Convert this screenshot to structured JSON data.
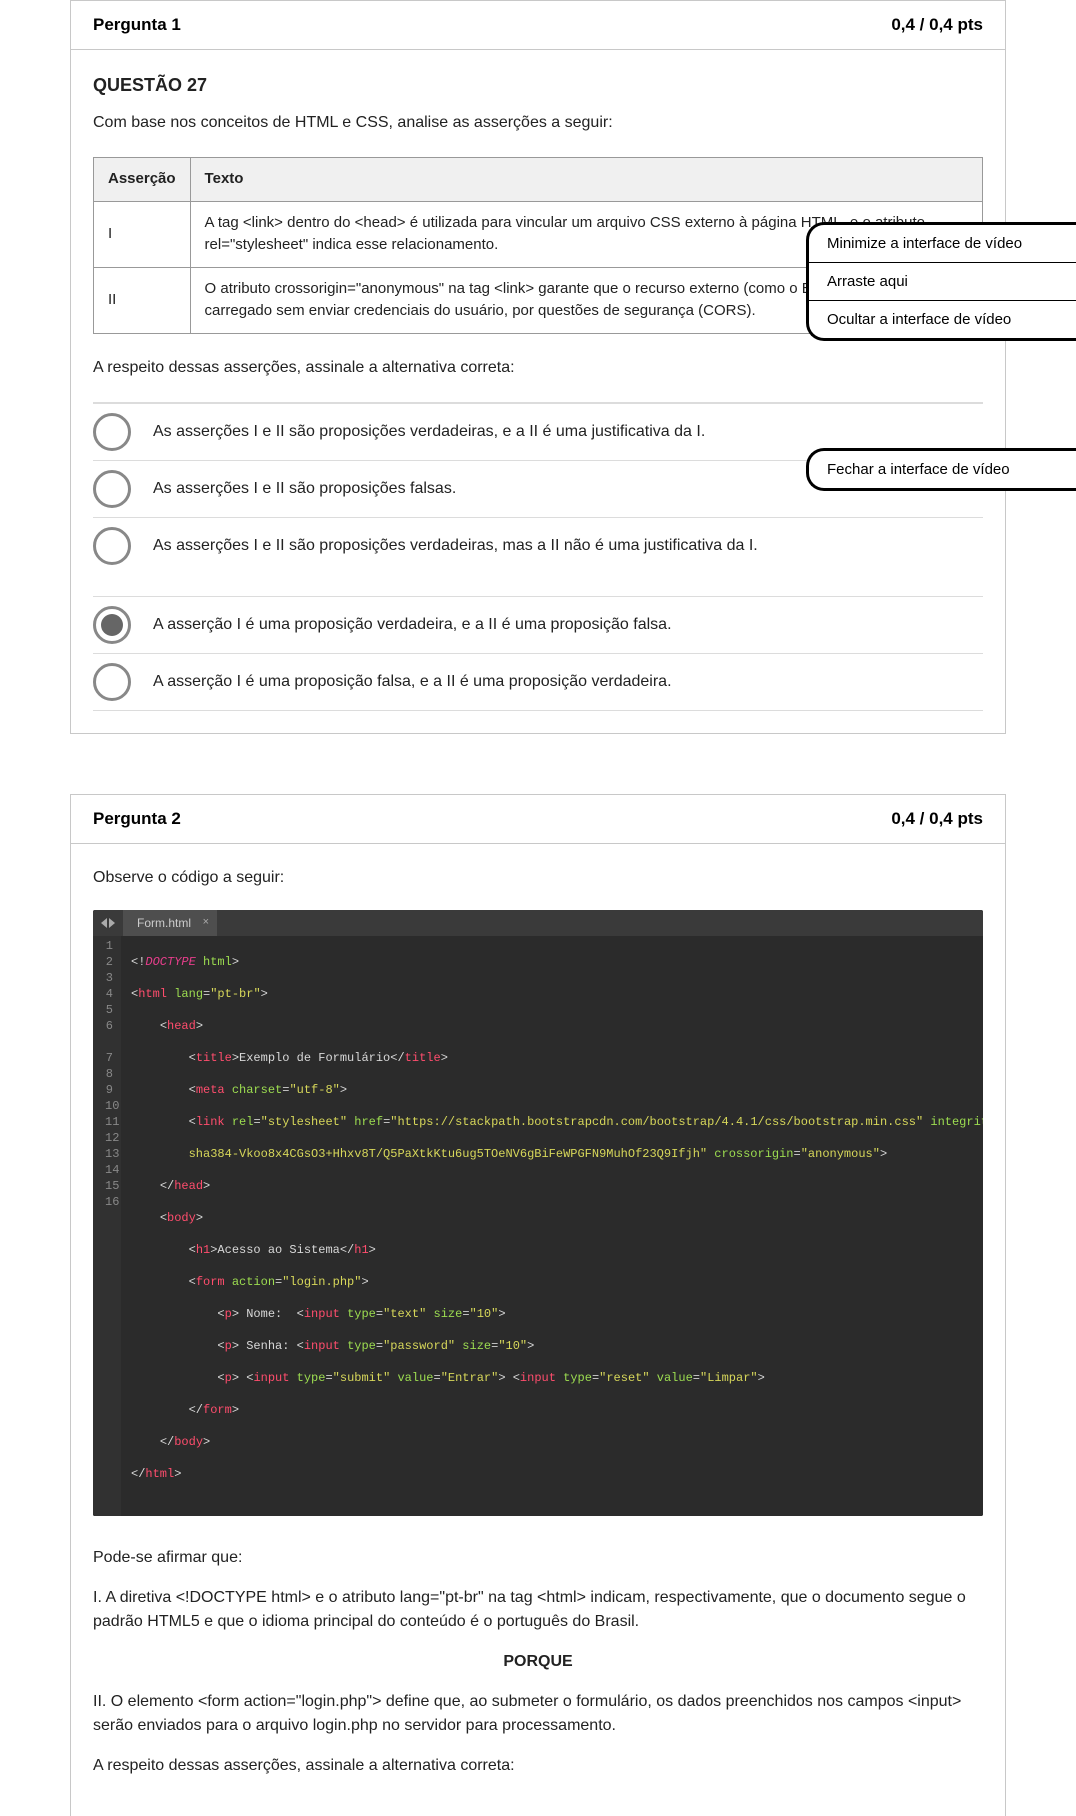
{
  "q1": {
    "header": "Pergunta 1",
    "points": "0,4 / 0,4 pts",
    "heading": "QUESTÃO 27",
    "intro": "Com base nos conceitos de HTML e CSS, analise as asserções a seguir:",
    "colLabel": "Asserção",
    "colText": "Texto",
    "assertions": [
      {
        "label": "I",
        "text": "A tag <link> dentro do <head> é utilizada para vincular um arquivo CSS externo à página HTML, e o atributo rel=\"stylesheet\" indica esse relacionamento."
      },
      {
        "label": "II",
        "text": "O atributo crossorigin=\"anonymous\" na tag <link> garante que o recurso externo (como o Bootstrap) seja carregado sem enviar credenciais do usuário, por questões de segurança (CORS)."
      }
    ],
    "linker": "A respeito dessas asserções, assinale a alternativa correta:",
    "options": [
      "As asserções I e II são proposições verdadeiras, e a II é uma justificativa da I.",
      "As asserções I e II são proposições falsas.",
      "As asserções I e II são proposições verdadeiras, mas a II não é uma justificativa da I.",
      "A asserção I é uma proposição verdadeira, e a II é uma proposição falsa.",
      "A asserção I é uma proposição falsa, e a II é uma proposição verdadeira."
    ],
    "selected": 3
  },
  "side1": {
    "rows": [
      "Minimize a interface de vídeo",
      "Arraste aqui",
      "Ocultar a interface de vídeo"
    ]
  },
  "side2": {
    "label": "Fechar a interface de vídeo"
  },
  "q2": {
    "header": "Pergunta 2",
    "points": "0,4 / 0,4 pts",
    "intro": "Observe o código a seguir:",
    "editor": {
      "tab": "Form.html",
      "lines": 16
    },
    "afterLead": "Pode-se afirmar que:",
    "afterI": "I. A diretiva <!DOCTYPE html> e o atributo lang=\"pt-br\" na tag <html> indicam, respectivamente, que o documento segue o padrão HTML5 e que o idioma principal do conteúdo é o português do Brasil.",
    "porque": "PORQUE",
    "afterII": "II. O elemento <form action=\"login.php\"> define que, ao submeter o formulário, os dados preenchidos nos campos <input> serão enviados para o arquivo login.php no servidor para processamento.",
    "afterLinker": "A respeito dessas asserções, assinale a alternativa correta:"
  }
}
